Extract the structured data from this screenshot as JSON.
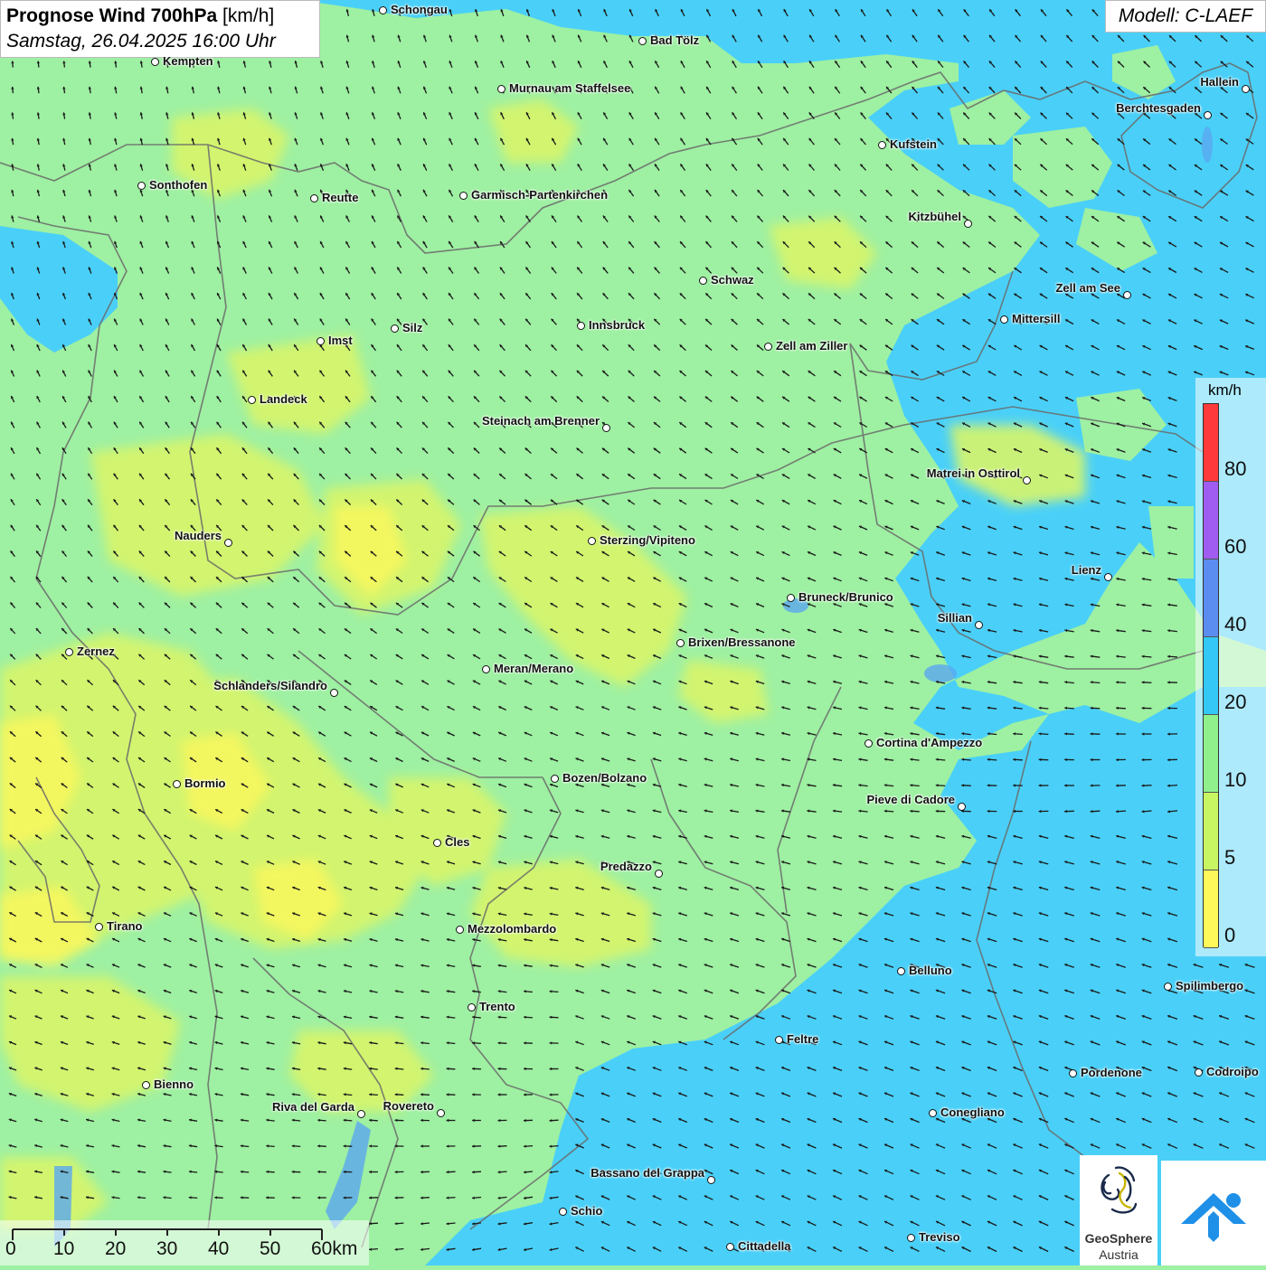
{
  "header": {
    "title_bold": "Prognose Wind 700hPa",
    "title_unit": " [km/h]",
    "datetime": "Samstag, 26.04.2025 16:00 Uhr",
    "model": "Modell: C-LAEF"
  },
  "legend": {
    "unit": "km/h",
    "classes": [
      {
        "label": "80",
        "color": "#ff3a3a"
      },
      {
        "label": "60",
        "color": "#a05cf0"
      },
      {
        "label": "40",
        "color": "#5b8cf0"
      },
      {
        "label": "20",
        "color": "#33c8f5"
      },
      {
        "label": "10",
        "color": "#8ff08c"
      },
      {
        "label": "5",
        "color": "#c8f562"
      },
      {
        "label": "0",
        "color": "#fff85a"
      }
    ]
  },
  "scalebar": {
    "labels": [
      "0",
      "10",
      "20",
      "30",
      "40",
      "50",
      "60km"
    ]
  },
  "logo": {
    "name": "GeoSphere",
    "sub": "Austria"
  },
  "colors": {
    "arrow": "#1a1a1a",
    "border": "#6a6a6a",
    "water": "#4ad0f8",
    "land_low": "#9ef0a2"
  },
  "cities": [
    {
      "name": "Schongau"
    },
    {
      "name": "Bad Tölz"
    },
    {
      "name": "Kempten"
    },
    {
      "name": "Murnau am Staffelsee"
    },
    {
      "name": "Hallein"
    },
    {
      "name": "Berchtesgaden"
    },
    {
      "name": "Kufstein"
    },
    {
      "name": "Sonthofen"
    },
    {
      "name": "Reutte"
    },
    {
      "name": "Garmisch-Partenkirchen"
    },
    {
      "name": "Kitzbühel"
    },
    {
      "name": "Schwaz"
    },
    {
      "name": "Zell am See"
    },
    {
      "name": "Mittersill"
    },
    {
      "name": "Silz"
    },
    {
      "name": "Innsbruck"
    },
    {
      "name": "Imst"
    },
    {
      "name": "Zell am Ziller"
    },
    {
      "name": "Landeck"
    },
    {
      "name": "Steinach am Brenner"
    },
    {
      "name": "Matrei in Osttirol"
    },
    {
      "name": "Nauders"
    },
    {
      "name": "Sterzing/Vipiteno"
    },
    {
      "name": "Lienz"
    },
    {
      "name": "Bruneck/Brunico"
    },
    {
      "name": "Sillian"
    },
    {
      "name": "Zernez"
    },
    {
      "name": "Brixen/Bressanone"
    },
    {
      "name": "Meran/Merano"
    },
    {
      "name": "Schlanders/Silandro"
    },
    {
      "name": "Cortina d'Ampezzo"
    },
    {
      "name": "Bozen/Bolzano"
    },
    {
      "name": "Bormio"
    },
    {
      "name": "Pieve di Cadore"
    },
    {
      "name": "Cles"
    },
    {
      "name": "Predazzo"
    },
    {
      "name": "Tirano"
    },
    {
      "name": "Mezzolombardo"
    },
    {
      "name": "Belluno"
    },
    {
      "name": "Spilimbergo"
    },
    {
      "name": "Trento"
    },
    {
      "name": "Feltre"
    },
    {
      "name": "Pordenone"
    },
    {
      "name": "Codroipo"
    },
    {
      "name": "Bienno"
    },
    {
      "name": "Riva del Garda"
    },
    {
      "name": "Rovereto"
    },
    {
      "name": "Conegliano"
    },
    {
      "name": "Bassano del Grappa"
    },
    {
      "name": "Schio"
    },
    {
      "name": "Treviso"
    },
    {
      "name": "Cittadella"
    }
  ]
}
